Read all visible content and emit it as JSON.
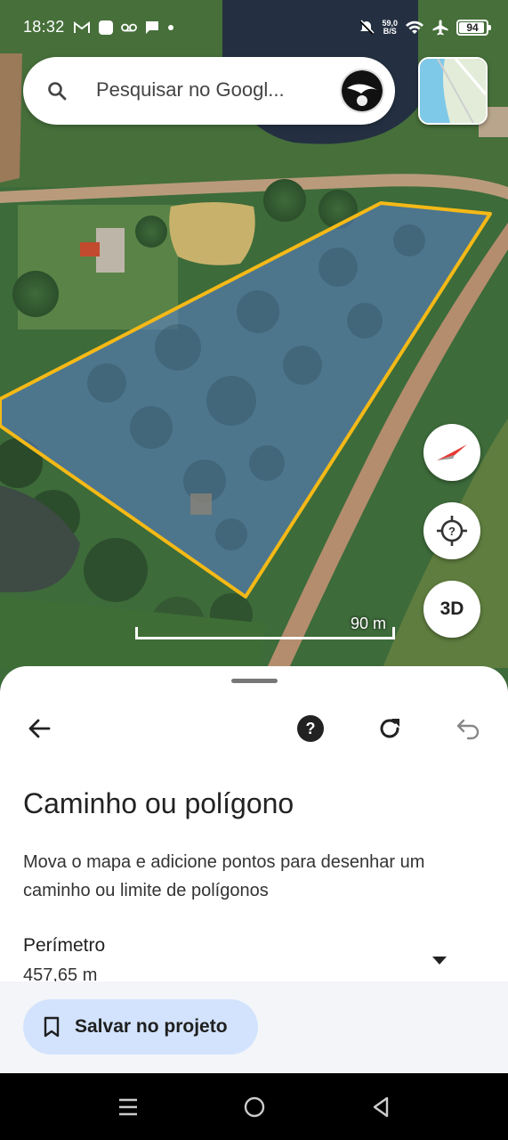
{
  "status_bar": {
    "time": "18:32",
    "net_speed_value": "59,0",
    "net_speed_unit": "B/S",
    "battery": "94",
    "battery_fraction": 0.94
  },
  "search": {
    "placeholder": "Pesquisar no Googl..."
  },
  "map": {
    "scale_label": "90 m",
    "btn_3d_label": "3D",
    "polygon_color": "#f5b916",
    "polygon_fill": "#5b7fd1"
  },
  "sheet": {
    "title": "Caminho ou polígono",
    "description": "Mova o mapa e adicione pontos para desenhar um caminho ou limite de polígonos",
    "metric_label": "Perímetro",
    "metric_value": "457,65 m",
    "save_button_label": "Salvar no projeto"
  },
  "icons": {
    "search": "search-icon",
    "compass": "compass-icon",
    "my_location": "my-location-icon",
    "back": "arrow-back-icon",
    "help": "help-icon",
    "refresh": "refresh-icon",
    "undo": "undo-icon",
    "bookmark": "bookmark-icon",
    "dropdown": "arrow-drop-down-icon"
  },
  "colors": {
    "save_button_bg": "#d3e3fd",
    "footer_bg": "#f3f5f9",
    "compass_red": "#e53935"
  }
}
